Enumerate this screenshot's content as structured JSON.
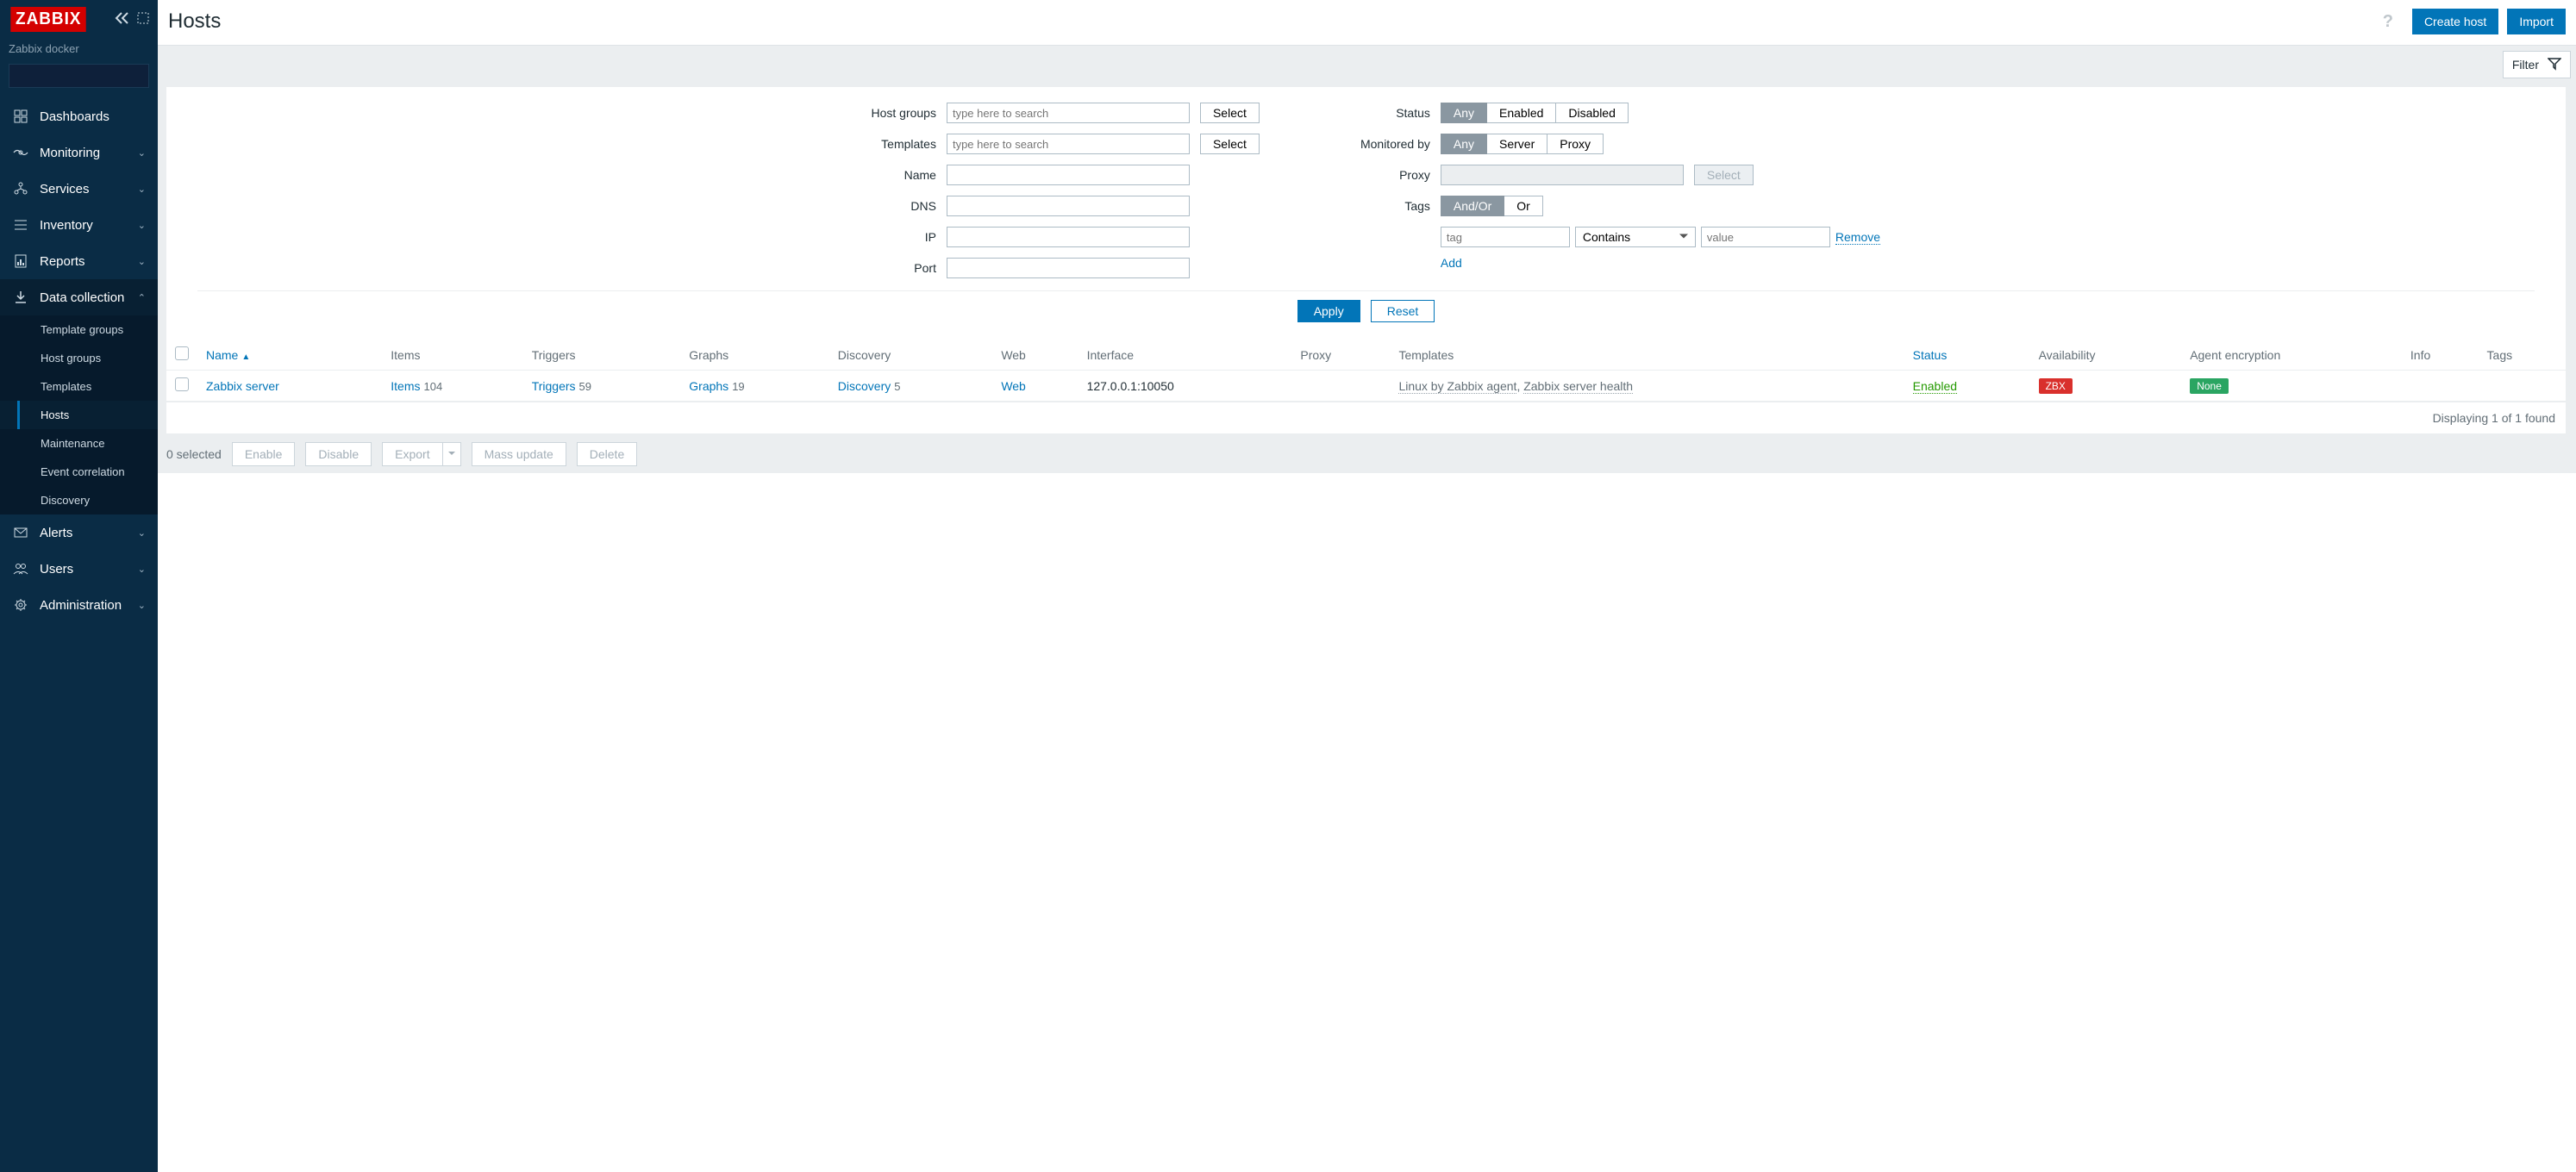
{
  "brand": {
    "logo": "ZABBIX",
    "subtitle": "Zabbix docker"
  },
  "nav": {
    "dashboards": "Dashboards",
    "monitoring": "Monitoring",
    "services": "Services",
    "inventory": "Inventory",
    "reports": "Reports",
    "data_collection": "Data collection",
    "dc_sub": {
      "template_groups": "Template groups",
      "host_groups": "Host groups",
      "templates": "Templates",
      "hosts": "Hosts",
      "maintenance": "Maintenance",
      "event_correlation": "Event correlation",
      "discovery": "Discovery"
    },
    "alerts": "Alerts",
    "users": "Users",
    "administration": "Administration"
  },
  "page": {
    "title": "Hosts",
    "create_host": "Create host",
    "import": "Import"
  },
  "filter": {
    "toggle": "Filter",
    "labels": {
      "host_groups": "Host groups",
      "templates": "Templates",
      "name": "Name",
      "dns": "DNS",
      "ip": "IP",
      "port": "Port",
      "status": "Status",
      "monitored_by": "Monitored by",
      "proxy": "Proxy",
      "tags": "Tags"
    },
    "placeholder": "type here to search",
    "select": "Select",
    "status_opts": {
      "any": "Any",
      "enabled": "Enabled",
      "disabled": "Disabled"
    },
    "mon_opts": {
      "any": "Any",
      "server": "Server",
      "proxy": "Proxy"
    },
    "tag_opts": {
      "andor": "And/Or",
      "or": "Or"
    },
    "tag_placeholder": "tag",
    "value_placeholder": "value",
    "contains": "Contains",
    "remove": "Remove",
    "add": "Add",
    "apply": "Apply",
    "reset": "Reset"
  },
  "table": {
    "cols": {
      "name": "Name",
      "items": "Items",
      "triggers": "Triggers",
      "graphs": "Graphs",
      "discovery": "Discovery",
      "web": "Web",
      "interface": "Interface",
      "proxy": "Proxy",
      "templates": "Templates",
      "status": "Status",
      "availability": "Availability",
      "agent_encryption": "Agent encryption",
      "info": "Info",
      "tags": "Tags"
    },
    "rows": [
      {
        "name": "Zabbix server",
        "items": "Items",
        "items_n": "104",
        "triggers": "Triggers",
        "triggers_n": "59",
        "graphs": "Graphs",
        "graphs_n": "19",
        "discovery": "Discovery",
        "discovery_n": "5",
        "web": "Web",
        "interface": "127.0.0.1:10050",
        "proxy": "",
        "templates_a": "Linux by Zabbix agent",
        "templates_sep": ", ",
        "templates_b": "Zabbix server health",
        "status": "Enabled",
        "availability": "ZBX",
        "encryption": "None"
      }
    ],
    "footer": "Displaying 1 of 1 found"
  },
  "bulk": {
    "selected": "0 selected",
    "enable": "Enable",
    "disable": "Disable",
    "export": "Export",
    "mass_update": "Mass update",
    "delete": "Delete"
  }
}
